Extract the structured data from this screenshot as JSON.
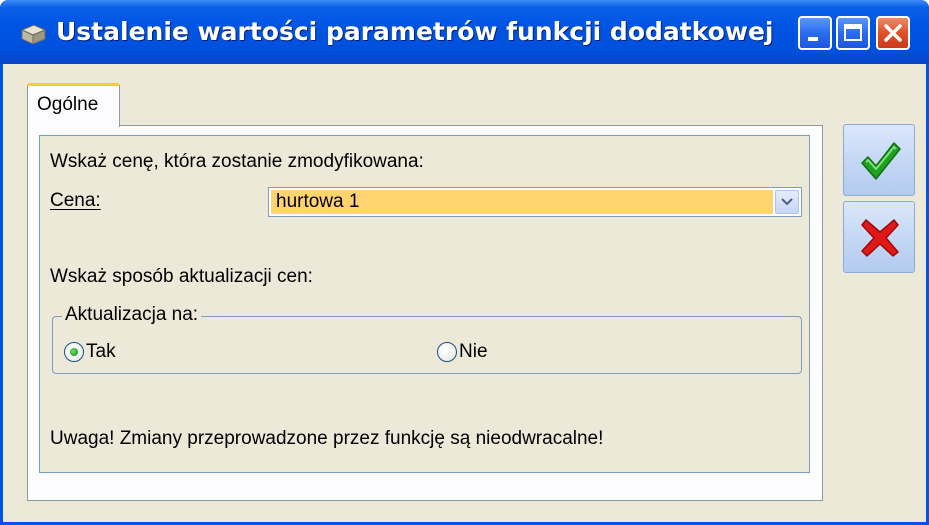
{
  "window": {
    "title": "Ustalenie wartości parametrów funkcji dodatkowej",
    "controls": [
      "minimize-icon",
      "maximize-icon",
      "close-icon"
    ]
  },
  "tabs": [
    {
      "label": "Ogólne",
      "active": true
    }
  ],
  "form": {
    "price_instruction": "Wskaż cenę, która zostanie zmodyfikowana:",
    "price_label": "Cena:",
    "price_value": "hurtowa 1",
    "update_instruction": "Wskaż sposób aktualizacji cen:",
    "update_group": {
      "legend": "Aktualizacja na:",
      "options": [
        {
          "label": "Tak",
          "selected": true
        },
        {
          "label": "Nie",
          "selected": false
        }
      ]
    },
    "warning": "Uwaga! Zmiany przeprowadzone przez funkcję są nieodwracalne!"
  },
  "actions": {
    "confirm_icon": "green-checkmark-icon",
    "cancel_icon": "red-x-icon"
  },
  "colors": {
    "titlebar": "#0054e3",
    "dialog_bg": "#ece9d8",
    "selection_bg": "#ffd46e",
    "tab_highlight": "#ffc83c",
    "confirm": "#21a121",
    "cancel": "#e01818"
  }
}
